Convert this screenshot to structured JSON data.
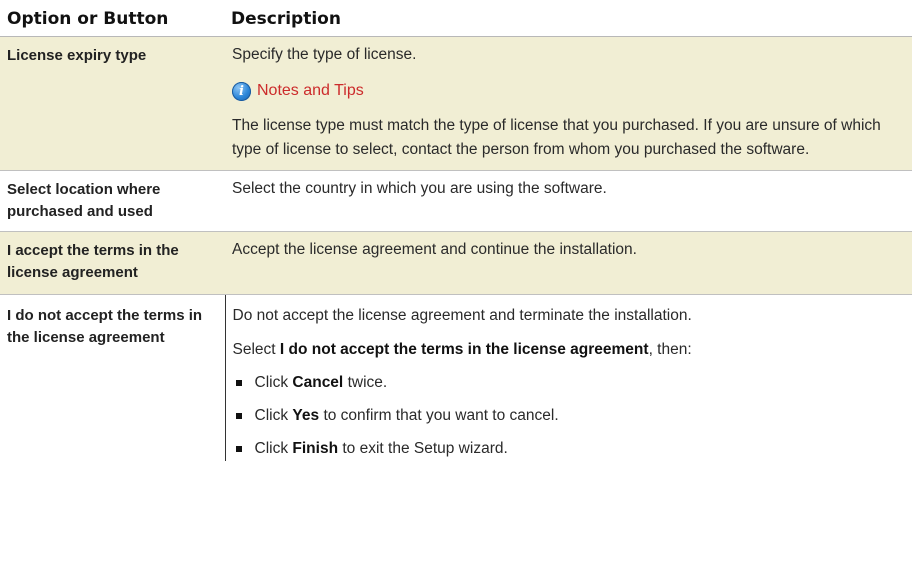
{
  "header": {
    "col1": "Option or Button",
    "col2": "Description"
  },
  "rows": [
    {
      "option": "License expiry type",
      "desc": "Specify the type of license.",
      "notes_title": "Notes and Tips",
      "notes_text": "The license type must match the type of license that you purchased. If you are unsure of which type of license to select, contact the person from whom you purchased the software."
    },
    {
      "option": "Select location where purchased and used",
      "desc": "Select the country in which you are using the software."
    },
    {
      "option": "I accept the terms in the license agreement",
      "desc": "Accept the license agreement and continue the installation."
    },
    {
      "option": "I do not accept the terms in the license agreement",
      "desc": "Do not accept the license agreement and terminate the installation.",
      "select_prefix": "Select",
      "select_bold": "I do not accept the terms in the license agreement",
      "select_suffix": ", then:",
      "steps": [
        {
          "pre": "Click",
          "bold": "Cancel",
          "post": "twice."
        },
        {
          "pre": "Click",
          "bold": "Yes",
          "post": "to confirm that you want to cancel."
        },
        {
          "pre": "Click",
          "bold": "Finish",
          "post": "to exit the Setup wizard."
        }
      ]
    }
  ],
  "colors": {
    "shaded_row": "#f1eed4",
    "notes_title": "#cc2b2b",
    "info_icon": "#2c86d8"
  },
  "icons": {
    "notes": "info-icon"
  }
}
